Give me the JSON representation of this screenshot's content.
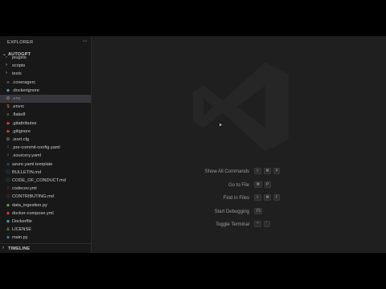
{
  "sidebar": {
    "title": "EXPLORER",
    "more": "···",
    "root": {
      "chevron": "⌄",
      "label": "AUTOGPT"
    },
    "items": [
      {
        "type": "folder",
        "icon": "›",
        "label": "plugins",
        "dim": false
      },
      {
        "type": "folder",
        "icon": "›",
        "label": "scripts",
        "dim": false
      },
      {
        "type": "folder",
        "icon": "›",
        "label": "tests",
        "dim": false
      },
      {
        "type": "file",
        "icon": "≡",
        "label": ".coveragerc",
        "dim": false
      },
      {
        "type": "file",
        "icon": "◆",
        "label": ".dockerignore",
        "dim": false
      },
      {
        "type": "file",
        "icon": "⚙",
        "label": ".env",
        "dim": true,
        "selected": true
      },
      {
        "type": "file",
        "icon": "$",
        "label": ".envrc",
        "dim": false
      },
      {
        "type": "file",
        "icon": "≡",
        "label": ".flake8",
        "dim": false
      },
      {
        "type": "file",
        "icon": "◆",
        "label": ".gitattributes",
        "dim": false
      },
      {
        "type": "file",
        "icon": "◆",
        "label": ".gitignore",
        "dim": false
      },
      {
        "type": "file",
        "icon": "⚙",
        "label": ".isort.cfg",
        "dim": false
      },
      {
        "type": "file",
        "icon": "!",
        "label": ".pre-commit-config.yaml",
        "dim": false
      },
      {
        "type": "file",
        "icon": "!",
        "label": ".sourcery.yaml",
        "dim": false
      },
      {
        "type": "file",
        "icon": "≡",
        "label": "azure.yaml.template",
        "dim": false
      },
      {
        "type": "file",
        "icon": "ⓘ",
        "label": "BULLETIN.md",
        "dim": false
      },
      {
        "type": "file",
        "icon": "ⓘ",
        "label": "CODE_OF_CONDUCT.md",
        "dim": false
      },
      {
        "type": "file",
        "icon": "!",
        "label": "codecov.yml",
        "dim": false
      },
      {
        "type": "file",
        "icon": "ⓘ",
        "label": "CONTRIBUTING.md",
        "dim": false
      },
      {
        "type": "file",
        "icon": "◈",
        "label": "data_ingestion.py",
        "dim": false
      },
      {
        "type": "file",
        "icon": "◆",
        "label": "docker-compose.yml",
        "dim": false
      },
      {
        "type": "file",
        "icon": "◆",
        "label": "Dockerfile",
        "dim": false
      },
      {
        "type": "file",
        "icon": "♙",
        "label": "LICENSE",
        "dim": false
      },
      {
        "type": "file",
        "icon": "◈",
        "label": "main.py",
        "dim": false
      }
    ],
    "timeline": {
      "chevron": "›",
      "label": "TIMELINE"
    }
  },
  "editor": {
    "cursor": "▸",
    "shortcuts": [
      {
        "name": "Show All Commands",
        "keys": [
          "⇧",
          "⌘",
          "P"
        ]
      },
      {
        "name": "Go to File",
        "keys": [
          "⌘",
          "P"
        ]
      },
      {
        "name": "Find in Files",
        "keys": [
          "⇧",
          "⌘",
          "F"
        ]
      },
      {
        "name": "Start Debugging",
        "keys": [
          "F5"
        ]
      },
      {
        "name": "Toggle Terminal",
        "keys": [
          "^",
          "`"
        ]
      }
    ]
  },
  "colors": {
    "background": "#1f1f1f",
    "sidebar": "#181818",
    "selection": "#37373d",
    "watermark": "#262626",
    "icon_blue": "#519aba",
    "icon_orange": "#e37933",
    "icon_yellow": "#cbcb41",
    "icon_red": "#cc3e44",
    "icon_green": "#8dc149",
    "icon_purple": "#a074c4",
    "icon_gray": "#9d9d9d"
  }
}
